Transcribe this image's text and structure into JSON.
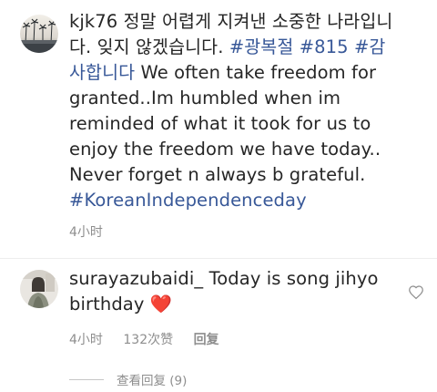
{
  "comments": [
    {
      "username": "kjk76",
      "text_parts": [
        {
          "text": " 정말 어렵게 지켜낸 소중한 나라입니다. 잊지 않겠습니다. ",
          "kind": "text"
        },
        {
          "text": "#광복절",
          "kind": "hashtag"
        },
        {
          "text": " ",
          "kind": "text"
        },
        {
          "text": "#815",
          "kind": "hashtag"
        },
        {
          "text": " ",
          "kind": "text"
        },
        {
          "text": "#감사합니다",
          "kind": "hashtag"
        },
        {
          "text": " We often take freedom for granted..Im humbled when im reminded of what it took for us to enjoy the freedom we have today.. Never forget n always b grateful. ",
          "kind": "text"
        },
        {
          "text": "#KoreanIndependenceday",
          "kind": "hashtag"
        }
      ],
      "time": "4小时"
    },
    {
      "username": "surayazubaidi_",
      "text_parts": [
        {
          "text": " Today is song jihyo birthday ",
          "kind": "text"
        },
        {
          "text": "❤️",
          "kind": "heart"
        }
      ],
      "time": "4小时",
      "likes": "132次赞",
      "reply_label": "回复"
    }
  ],
  "view_replies": "查看回复 (9)",
  "colors": {
    "text": "#262626",
    "hashtag": "#385898",
    "meta": "#8e8e8e",
    "heart": "#d91f2b"
  },
  "icons": {
    "avatar_1": "palm-trees-avatar",
    "avatar_2": "person-avatar",
    "like": "heart-outline-icon"
  }
}
